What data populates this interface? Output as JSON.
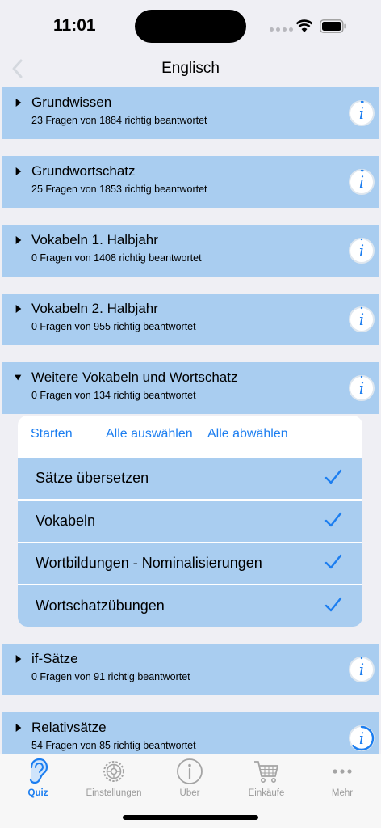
{
  "status": {
    "time": "11:01"
  },
  "nav": {
    "title": "Englisch"
  },
  "sections": [
    {
      "title": "Grundwissen",
      "subtitle": "23 Fragen von 1884 richtig beantwortet",
      "progress": 0.012
    },
    {
      "title": "Grundwortschatz",
      "subtitle": "25 Fragen von 1853 richtig beantwortet",
      "progress": 0.013
    },
    {
      "title": "Vokabeln 1. Halbjahr",
      "subtitle": "0 Fragen von 1408 richtig beantwortet",
      "progress": 0
    },
    {
      "title": "Vokabeln 2. Halbjahr",
      "subtitle": "0 Fragen von 955 richtig beantwortet",
      "progress": 0
    },
    {
      "title": "Weitere Vokabeln und Wortschatz",
      "subtitle": "0 Fragen von 134 richtig beantwortet",
      "progress": 0,
      "expanded": true
    },
    {
      "title": "if-Sätze",
      "subtitle": "0 Fragen von 91 richtig beantwortet",
      "progress": 0
    },
    {
      "title": "Relativsätze",
      "subtitle": "54 Fragen von 85 richtig beantwortet",
      "progress": 0.635
    }
  ],
  "card": {
    "start_label": "Starten",
    "select_all_label": "Alle auswählen",
    "deselect_all_label": "Alle abwählen",
    "items": [
      {
        "label": "Sätze übersetzen",
        "checked": true
      },
      {
        "label": "Vokabeln",
        "checked": true
      },
      {
        "label": "Wortbildungen - Nominalisierungen",
        "checked": true
      },
      {
        "label": "Wortschatzübungen",
        "checked": true
      }
    ]
  },
  "tabs": [
    {
      "label": "Quiz",
      "icon": "ear-icon",
      "active": true
    },
    {
      "label": "Einstellungen",
      "icon": "gear-icon",
      "active": false
    },
    {
      "label": "Über",
      "icon": "info-icon",
      "active": false
    },
    {
      "label": "Einkäufe",
      "icon": "cart-icon",
      "active": false
    },
    {
      "label": "Mehr",
      "icon": "more-icon",
      "active": false
    }
  ],
  "colors": {
    "accent": "#1c7ef0",
    "row_background": "#a9cdf0",
    "page_background": "#efeff4"
  }
}
